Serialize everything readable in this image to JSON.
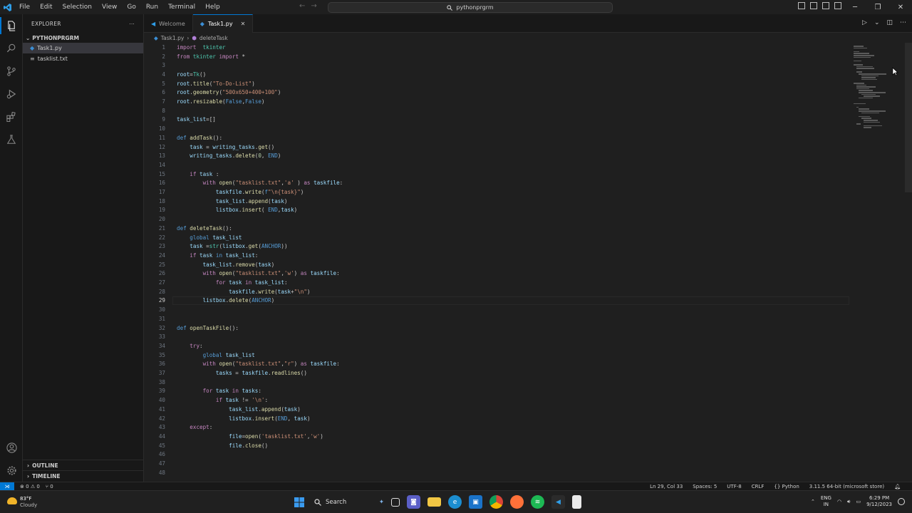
{
  "titlebar": {
    "menu": [
      "File",
      "Edit",
      "Selection",
      "View",
      "Go",
      "Run",
      "Terminal",
      "Help"
    ],
    "search_text": "pythonprgrm"
  },
  "sidebar": {
    "title": "EXPLORER",
    "folder": "PYTHONPRGRM",
    "files": [
      {
        "name": "Task1.py",
        "icon": "python-file-icon"
      },
      {
        "name": "tasklist.txt",
        "icon": "text-file-icon"
      }
    ],
    "outline": "OUTLINE",
    "timeline": "TIMELINE"
  },
  "tabs": [
    {
      "label": "Welcome",
      "icon": "vscode-icon"
    },
    {
      "label": "Task1.py",
      "icon": "python-file-icon"
    }
  ],
  "breadcrumb": {
    "file": "Task1.py",
    "symbol": "deleteTask"
  },
  "editor": {
    "current_line": 29,
    "lines": [
      [
        [
          "kw",
          "import"
        ],
        [
          "",
          "  "
        ],
        [
          "cls",
          "tkinter"
        ]
      ],
      [
        [
          "kw",
          "from"
        ],
        [
          "",
          " "
        ],
        [
          "cls",
          "tkinter"
        ],
        [
          "",
          " "
        ],
        [
          "kw",
          "import"
        ],
        [
          "",
          " *"
        ]
      ],
      [],
      [
        [
          "var",
          "root"
        ],
        [
          "",
          "="
        ],
        [
          "cls",
          "Tk"
        ],
        [
          "",
          "()"
        ]
      ],
      [
        [
          "var",
          "root"
        ],
        [
          "",
          "."
        ],
        [
          "fn",
          "title"
        ],
        [
          "",
          "("
        ],
        [
          "str",
          "\"To-Do-List\""
        ],
        [
          "",
          ")"
        ]
      ],
      [
        [
          "var",
          "root"
        ],
        [
          "",
          "."
        ],
        [
          "fn",
          "geometry"
        ],
        [
          "",
          "("
        ],
        [
          "str",
          "\"500x650+400+100\""
        ],
        [
          "",
          ")"
        ]
      ],
      [
        [
          "var",
          "root"
        ],
        [
          "",
          "."
        ],
        [
          "fn",
          "resizable"
        ],
        [
          "",
          "("
        ],
        [
          "bl",
          "False"
        ],
        [
          "",
          ","
        ],
        [
          "bl",
          "False"
        ],
        [
          "",
          ")"
        ]
      ],
      [],
      [
        [
          "var",
          "task_list"
        ],
        [
          "",
          "=[]"
        ]
      ],
      [],
      [
        [
          "bl",
          "def"
        ],
        [
          "",
          " "
        ],
        [
          "fn",
          "addTask"
        ],
        [
          "",
          "():"
        ]
      ],
      [
        [
          "",
          "    "
        ],
        [
          "var",
          "task"
        ],
        [
          "",
          " = "
        ],
        [
          "var",
          "writing_tasks"
        ],
        [
          "",
          "."
        ],
        [
          "fn",
          "get"
        ],
        [
          "",
          "()"
        ]
      ],
      [
        [
          "",
          "    "
        ],
        [
          "var",
          "writing_tasks"
        ],
        [
          "",
          "."
        ],
        [
          "fn",
          "delete"
        ],
        [
          "",
          "("
        ],
        [
          "num",
          "0"
        ],
        [
          "",
          ", "
        ],
        [
          "bl",
          "END"
        ],
        [
          "",
          ")"
        ]
      ],
      [],
      [
        [
          "",
          "    "
        ],
        [
          "kw",
          "if"
        ],
        [
          "",
          " "
        ],
        [
          "var",
          "task"
        ],
        [
          "",
          " :"
        ]
      ],
      [
        [
          "",
          "        "
        ],
        [
          "kw",
          "with"
        ],
        [
          "",
          " "
        ],
        [
          "fn",
          "open"
        ],
        [
          "",
          "("
        ],
        [
          "str",
          "\"tasklist.txt\""
        ],
        [
          "",
          ","
        ],
        [
          "str",
          "'a'"
        ],
        [
          "",
          " ) "
        ],
        [
          "kw",
          "as"
        ],
        [
          "",
          " "
        ],
        [
          "var",
          "taskfile"
        ],
        [
          "",
          ":"
        ]
      ],
      [
        [
          "",
          "            "
        ],
        [
          "var",
          "taskfile"
        ],
        [
          "",
          "."
        ],
        [
          "fn",
          "write"
        ],
        [
          "",
          "("
        ],
        [
          "bl",
          "f"
        ],
        [
          "str",
          "\"\\n{task}\""
        ],
        [
          "",
          ")"
        ]
      ],
      [
        [
          "",
          "            "
        ],
        [
          "var",
          "task_list"
        ],
        [
          "",
          "."
        ],
        [
          "fn",
          "append"
        ],
        [
          "",
          "("
        ],
        [
          "var",
          "task"
        ],
        [
          "",
          ")"
        ]
      ],
      [
        [
          "",
          "            "
        ],
        [
          "var",
          "listbox"
        ],
        [
          "",
          "."
        ],
        [
          "fn",
          "insert"
        ],
        [
          "",
          "( "
        ],
        [
          "bl",
          "END"
        ],
        [
          "",
          ","
        ],
        [
          "var",
          "task"
        ],
        [
          "",
          ")"
        ]
      ],
      [],
      [
        [
          "bl",
          "def"
        ],
        [
          "",
          " "
        ],
        [
          "fn",
          "deleteTask"
        ],
        [
          "",
          "():"
        ]
      ],
      [
        [
          "",
          "    "
        ],
        [
          "bl",
          "global"
        ],
        [
          "",
          " "
        ],
        [
          "var",
          "task_list"
        ]
      ],
      [
        [
          "",
          "    "
        ],
        [
          "var",
          "task"
        ],
        [
          "",
          " ="
        ],
        [
          "cls",
          "str"
        ],
        [
          "",
          "("
        ],
        [
          "var",
          "listbox"
        ],
        [
          "",
          "."
        ],
        [
          "fn",
          "get"
        ],
        [
          "",
          "("
        ],
        [
          "bl",
          "ANCHOR"
        ],
        [
          "",
          "))"
        ]
      ],
      [
        [
          "",
          "    "
        ],
        [
          "kw",
          "if"
        ],
        [
          "",
          " "
        ],
        [
          "var",
          "task"
        ],
        [
          "",
          " "
        ],
        [
          "bl",
          "in"
        ],
        [
          "",
          " "
        ],
        [
          "var",
          "task_list"
        ],
        [
          "",
          ":"
        ]
      ],
      [
        [
          "",
          "        "
        ],
        [
          "var",
          "task_list"
        ],
        [
          "",
          "."
        ],
        [
          "fn",
          "remove"
        ],
        [
          "",
          "("
        ],
        [
          "var",
          "task"
        ],
        [
          "",
          ")"
        ]
      ],
      [
        [
          "",
          "        "
        ],
        [
          "kw",
          "with"
        ],
        [
          "",
          " "
        ],
        [
          "fn",
          "open"
        ],
        [
          "",
          "("
        ],
        [
          "str",
          "\"tasklist.txt\""
        ],
        [
          "",
          ","
        ],
        [
          "str",
          "'w'"
        ],
        [
          "",
          ") "
        ],
        [
          "kw",
          "as"
        ],
        [
          "",
          " "
        ],
        [
          "var",
          "taskfile"
        ],
        [
          "",
          ":"
        ]
      ],
      [
        [
          "",
          "            "
        ],
        [
          "kw",
          "for"
        ],
        [
          "",
          " "
        ],
        [
          "var",
          "task"
        ],
        [
          "",
          " "
        ],
        [
          "kw",
          "in"
        ],
        [
          "",
          " "
        ],
        [
          "var",
          "task_list"
        ],
        [
          "",
          ":"
        ]
      ],
      [
        [
          "",
          "                "
        ],
        [
          "var",
          "taskfile"
        ],
        [
          "",
          "."
        ],
        [
          "fn",
          "write"
        ],
        [
          "",
          "("
        ],
        [
          "var",
          "task"
        ],
        [
          "",
          "+"
        ],
        [
          "str",
          "\"\\n\""
        ],
        [
          "",
          ")"
        ]
      ],
      [
        [
          "",
          "        "
        ],
        [
          "var",
          "listbox"
        ],
        [
          "",
          "."
        ],
        [
          "fn",
          "delete"
        ],
        [
          "",
          "("
        ],
        [
          "bl",
          "ANCHOR"
        ],
        [
          "",
          ")"
        ]
      ],
      [],
      [],
      [
        [
          "bl",
          "def"
        ],
        [
          "",
          " "
        ],
        [
          "fn",
          "openTaskFile"
        ],
        [
          "",
          "():"
        ]
      ],
      [],
      [
        [
          "",
          "    "
        ],
        [
          "kw",
          "try"
        ],
        [
          "",
          ":"
        ]
      ],
      [
        [
          "",
          "        "
        ],
        [
          "bl",
          "global"
        ],
        [
          "",
          " "
        ],
        [
          "var",
          "task_list"
        ]
      ],
      [
        [
          "",
          "        "
        ],
        [
          "kw",
          "with"
        ],
        [
          "",
          " "
        ],
        [
          "fn",
          "open"
        ],
        [
          "",
          "("
        ],
        [
          "str",
          "\"tasklist.txt\""
        ],
        [
          "",
          ","
        ],
        [
          "str",
          "\"r\""
        ],
        [
          "",
          ") "
        ],
        [
          "kw",
          "as"
        ],
        [
          "",
          " "
        ],
        [
          "var",
          "taskfile"
        ],
        [
          "",
          ":"
        ]
      ],
      [
        [
          "",
          "            "
        ],
        [
          "var",
          "tasks"
        ],
        [
          "",
          " = "
        ],
        [
          "var",
          "taskfile"
        ],
        [
          "",
          "."
        ],
        [
          "fn",
          "readlines"
        ],
        [
          "",
          "()"
        ]
      ],
      [],
      [
        [
          "",
          "        "
        ],
        [
          "kw",
          "for"
        ],
        [
          "",
          " "
        ],
        [
          "var",
          "task"
        ],
        [
          "",
          " "
        ],
        [
          "kw",
          "in"
        ],
        [
          "",
          " "
        ],
        [
          "var",
          "tasks"
        ],
        [
          "",
          ":"
        ]
      ],
      [
        [
          "",
          "            "
        ],
        [
          "kw",
          "if"
        ],
        [
          "",
          " "
        ],
        [
          "var",
          "task"
        ],
        [
          "",
          " != "
        ],
        [
          "str",
          "'\\n'"
        ],
        [
          "",
          ":"
        ]
      ],
      [
        [
          "",
          "                "
        ],
        [
          "var",
          "task_list"
        ],
        [
          "",
          "."
        ],
        [
          "fn",
          "append"
        ],
        [
          "",
          "("
        ],
        [
          "var",
          "task"
        ],
        [
          "",
          ")"
        ]
      ],
      [
        [
          "",
          "                "
        ],
        [
          "var",
          "listbox"
        ],
        [
          "",
          "."
        ],
        [
          "fn",
          "insert"
        ],
        [
          "",
          "("
        ],
        [
          "bl",
          "END"
        ],
        [
          "",
          ", "
        ],
        [
          "var",
          "task"
        ],
        [
          "",
          ")"
        ]
      ],
      [
        [
          "",
          "    "
        ],
        [
          "kw",
          "except"
        ],
        [
          "",
          ":"
        ]
      ],
      [
        [
          "",
          "                "
        ],
        [
          "var",
          "file"
        ],
        [
          "",
          "="
        ],
        [
          "fn",
          "open"
        ],
        [
          "",
          "("
        ],
        [
          "str",
          "'tasklist.txt'"
        ],
        [
          "",
          ","
        ],
        [
          "str",
          "'w'"
        ],
        [
          "",
          ")"
        ]
      ],
      [
        [
          "",
          "                "
        ],
        [
          "var",
          "file"
        ],
        [
          "",
          "."
        ],
        [
          "fn",
          "close"
        ],
        [
          "",
          "()"
        ]
      ],
      [],
      [],
      [
        [
          "",
          "                                  "
        ]
      ]
    ]
  },
  "statusbar": {
    "errors": "0",
    "warnings": "0",
    "ports": "0",
    "position": "Ln 29, Col 33",
    "spaces": "Spaces: 5",
    "encoding": "UTF-8",
    "eol": "CRLF",
    "language": "Python",
    "interpreter": "3.11.5 64-bit (microsoft store)"
  },
  "taskbar": {
    "temperature": "83°F",
    "condition": "Cloudy",
    "search_label": "Search",
    "lang_line1": "ENG",
    "lang_line2": "IN",
    "time": "6:29 PM",
    "date": "9/12/2023"
  },
  "colors": {
    "accent": "#0078d4",
    "background": "#1f1f1f"
  }
}
